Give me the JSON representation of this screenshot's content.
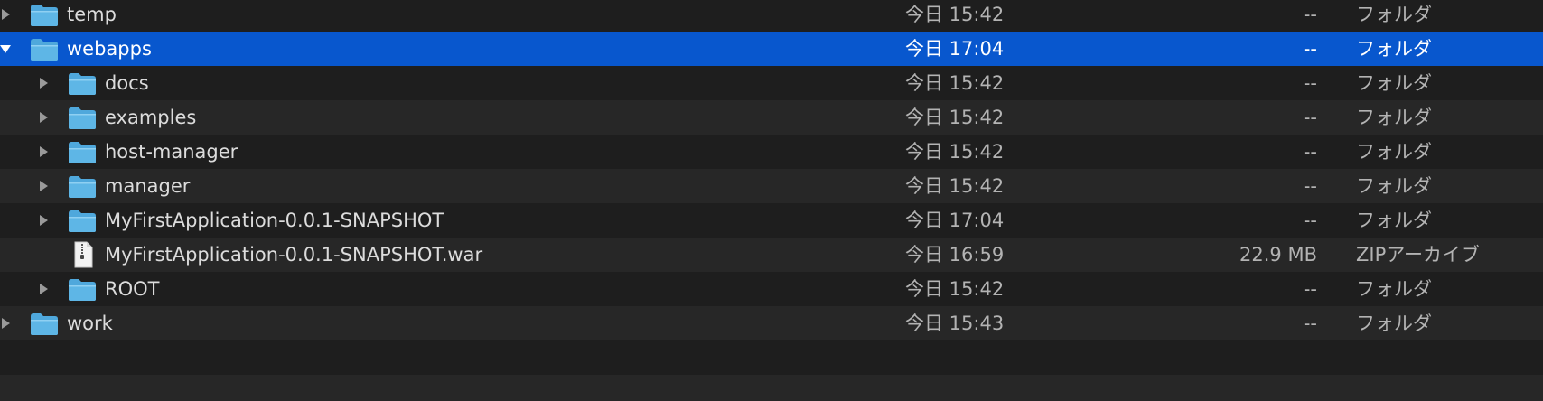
{
  "colors": {
    "selection": "#0857ce",
    "row_odd": "#1e1e1e",
    "row_even": "#272727",
    "folder_blue": "#4fa8dc"
  },
  "rows": [
    {
      "name": "temp",
      "date": "今日 15:42",
      "size": "--",
      "kind": "フォルダ",
      "icon": "folder-icon",
      "toggle": "collapsed",
      "level": 0,
      "selected": false
    },
    {
      "name": "webapps",
      "date": "今日 17:04",
      "size": "--",
      "kind": "フォルダ",
      "icon": "folder-icon",
      "toggle": "expanded",
      "level": 0,
      "selected": true
    },
    {
      "name": "docs",
      "date": "今日 15:42",
      "size": "--",
      "kind": "フォルダ",
      "icon": "folder-icon",
      "toggle": "collapsed",
      "level": 1,
      "selected": false
    },
    {
      "name": "examples",
      "date": "今日 15:42",
      "size": "--",
      "kind": "フォルダ",
      "icon": "folder-icon",
      "toggle": "collapsed",
      "level": 1,
      "selected": false
    },
    {
      "name": "host-manager",
      "date": "今日 15:42",
      "size": "--",
      "kind": "フォルダ",
      "icon": "folder-icon",
      "toggle": "collapsed",
      "level": 1,
      "selected": false
    },
    {
      "name": "manager",
      "date": "今日 15:42",
      "size": "--",
      "kind": "フォルダ",
      "icon": "folder-icon",
      "toggle": "collapsed",
      "level": 1,
      "selected": false
    },
    {
      "name": "MyFirstApplication-0.0.1-SNAPSHOT",
      "date": "今日 17:04",
      "size": "--",
      "kind": "フォルダ",
      "icon": "folder-icon",
      "toggle": "collapsed",
      "level": 1,
      "selected": false
    },
    {
      "name": "MyFirstApplication-0.0.1-SNAPSHOT.war",
      "date": "今日 16:59",
      "size": "22.9 MB",
      "kind": "ZIPアーカイブ",
      "icon": "zip-file-icon",
      "toggle": "none",
      "level": 1,
      "selected": false
    },
    {
      "name": "ROOT",
      "date": "今日 15:42",
      "size": "--",
      "kind": "フォルダ",
      "icon": "folder-icon",
      "toggle": "collapsed",
      "level": 1,
      "selected": false
    },
    {
      "name": "work",
      "date": "今日 15:43",
      "size": "--",
      "kind": "フォルダ",
      "icon": "folder-icon",
      "toggle": "collapsed",
      "level": 0,
      "selected": false
    }
  ]
}
